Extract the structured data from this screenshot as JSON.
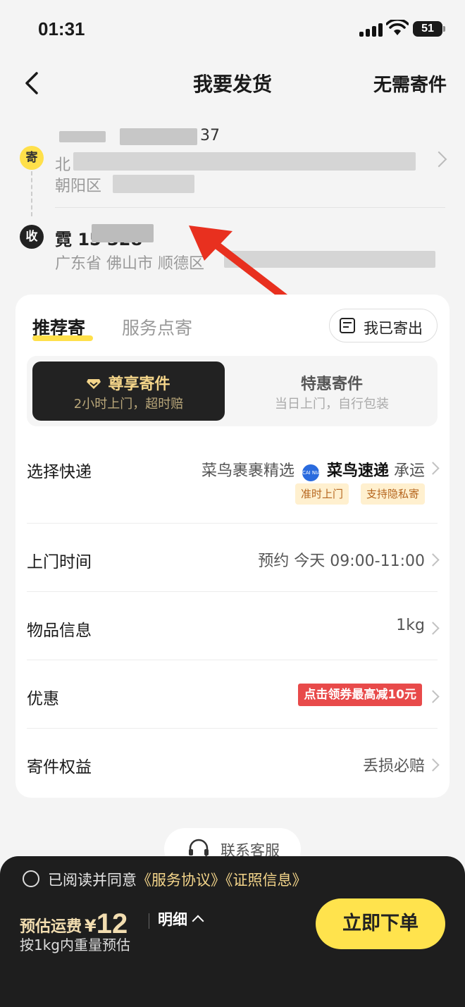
{
  "status_bar": {
    "time": "01:31",
    "battery": "51"
  },
  "header": {
    "title": "我要发货",
    "right_action": "无需寄件"
  },
  "sender": {
    "badge": "寄",
    "name_phone": "37",
    "address_line1": "北",
    "address_line2": "朝阳区"
  },
  "receiver": {
    "badge": "收",
    "name_phone": "霓 15       328",
    "address": "广东省 佛山市 顺德区"
  },
  "tabs": {
    "recommended": "推荐寄",
    "service_point": "服务点寄",
    "already_sent": "我已寄出"
  },
  "service_options": {
    "premium": {
      "title": "尊享寄件",
      "subtitle": "2小时上门，超时赔"
    },
    "discount": {
      "title": "特惠寄件",
      "subtitle": "当日上门，自行包装"
    }
  },
  "rows": {
    "courier": {
      "label": "选择快递",
      "prefix": "菜鸟裹裹精选",
      "logo_text": "CAI NIAO",
      "courier_name": "菜鸟速递",
      "suffix": "承运",
      "tags": [
        "准时上门",
        "支持隐私寄"
      ]
    },
    "pickup_time": {
      "label": "上门时间",
      "value": "预约 今天 09:00-11:00"
    },
    "item_info": {
      "label": "物品信息",
      "value": "1kg"
    },
    "discount": {
      "label": "优惠",
      "coupon": "点击领券最高减10元"
    },
    "benefits": {
      "label": "寄件权益",
      "value": "丢损必赔"
    }
  },
  "customer_service": {
    "label": "联系客服"
  },
  "bottom_bar": {
    "agree_prefix": "已阅读并同意",
    "agree_link1": "《服务协议》",
    "agree_link2": "《证照信息》",
    "price_label": "预估运费",
    "currency": "¥",
    "price": "12",
    "detail": "明细",
    "estimate_note": "按1kg内重量预估",
    "order_button": "立即下单"
  },
  "colors": {
    "accent_yellow": "#ffe34d",
    "premium_bg": "#222222",
    "coupon_red": "#e84a4a",
    "annotation_arrow": "#e8301f"
  }
}
